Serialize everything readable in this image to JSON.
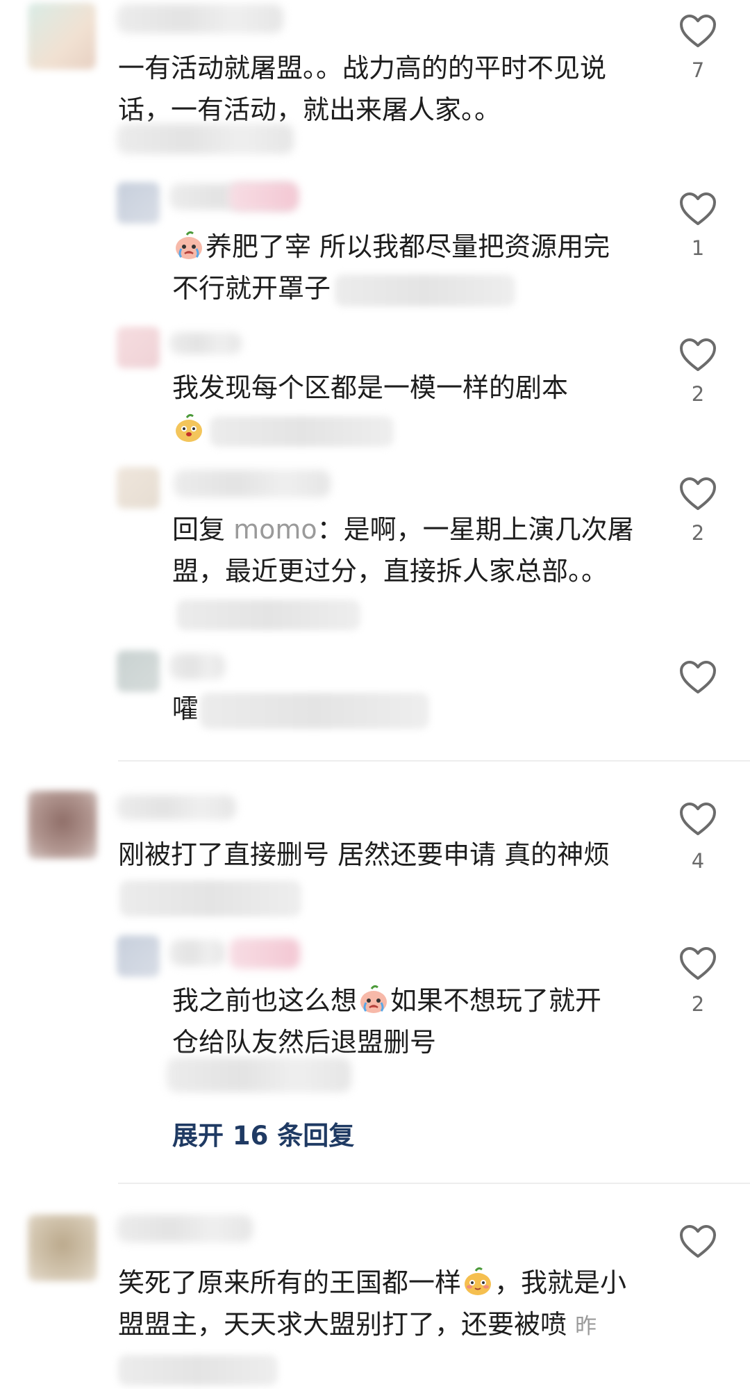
{
  "comments": [
    {
      "text": "一有活动就屠盟。。战力高的的平时不见说话，一有活动，就出来屠人家。。",
      "likes": "7"
    },
    {
      "text": "养肥了宰 所以我都尽量把资源用完 不行就开罩子",
      "likes": "1"
    },
    {
      "text": "我发现每个区都是一模一样的剧本",
      "likes": "2"
    },
    {
      "reply_prefix": "回复",
      "mention": "momo",
      "text": "：是啊，一星期上演几次屠盟，最近更过分，直接拆人家总部。。",
      "likes": "2"
    },
    {
      "text": "嚯",
      "likes": ""
    },
    {
      "text": "刚被打了直接删号 居然还要申请 真的神烦",
      "likes": "4"
    },
    {
      "text_a": "我之前也这么想",
      "text_b": "如果不想玩了就开仓给队友然后退盟删号",
      "likes": "2"
    },
    {
      "text_a": "笑死了原来所有的王国都一样",
      "text_b": "，我就是小盟盟主，天天求大盟别打了，还要被喷",
      "meta": "昨"
    }
  ],
  "expand_replies": {
    "label": "展开 16 条回复"
  },
  "icons": {
    "like": "heart-outline-icon",
    "emoji_cry": "crying-pear-emoji",
    "emoji_doge": "doge-pear-emoji",
    "emoji_shy": "shy-pear-emoji"
  },
  "colors": {
    "link": "#1f3a63",
    "meta": "#6a6a6a",
    "divider": "#ededed"
  }
}
